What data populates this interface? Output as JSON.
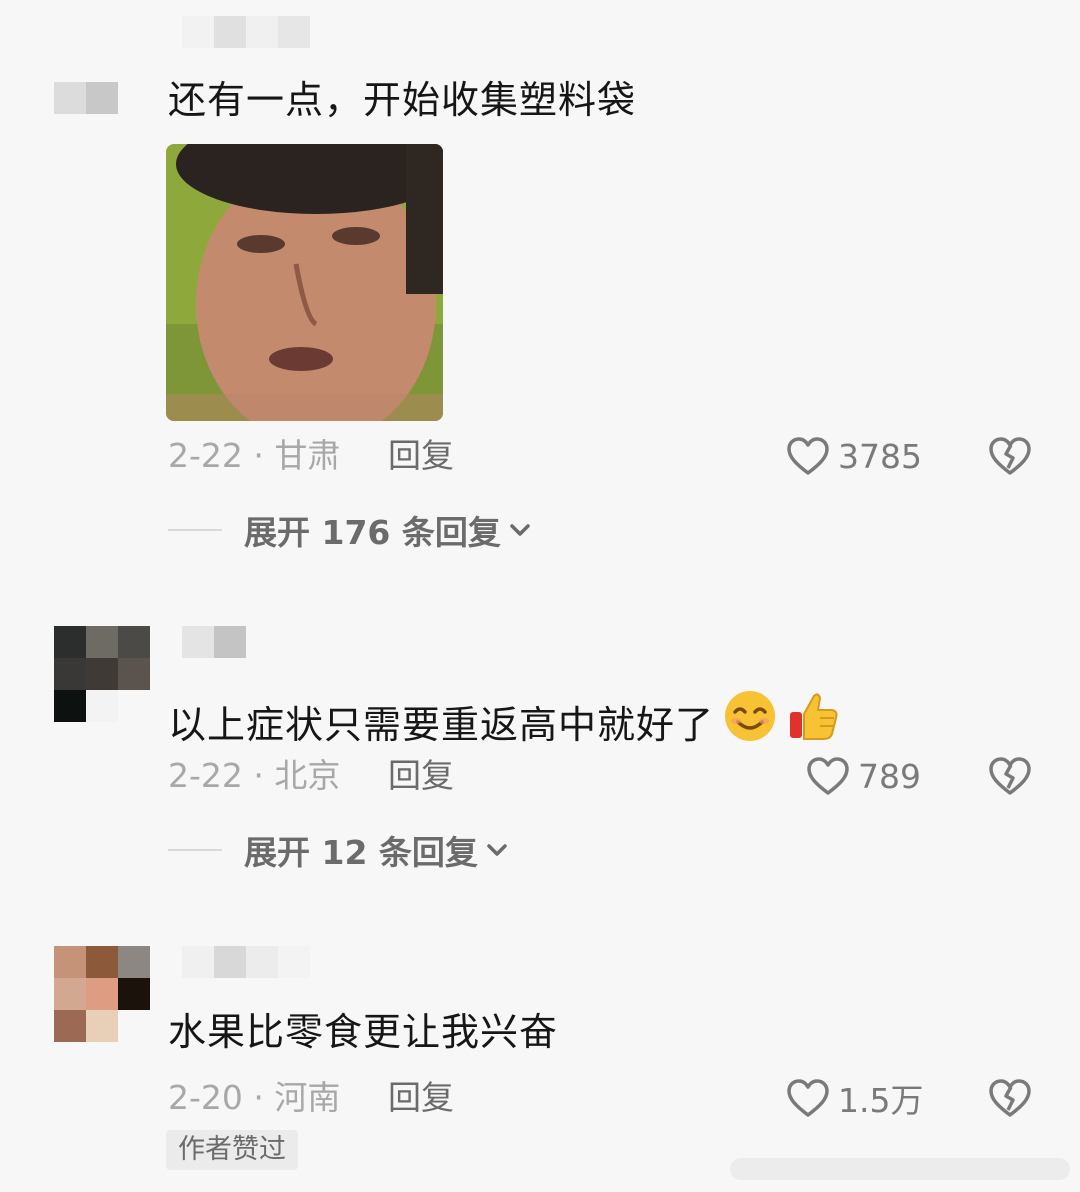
{
  "comments": [
    {
      "text": "还有一点，开始收集塑料袋",
      "date_location": "2-22 · 甘肃",
      "reply_label": "回复",
      "likes": "3785",
      "expand_label": "展开 176 条回复"
    },
    {
      "text": "以上症状只需要重返高中就好了",
      "emojis": [
        "smiling-face-icon",
        "thumbs-up-icon"
      ],
      "date_location": "2-22 · 北京",
      "reply_label": "回复",
      "likes": "789",
      "expand_label": "展开 12 条回复"
    },
    {
      "text": "水果比零食更让我兴奋",
      "date_location": "2-20 · 河南",
      "reply_label": "回复",
      "likes": "1.5万",
      "badge": "作者赞过"
    }
  ],
  "colors": {
    "background": "#f7f7f7",
    "text": "#161616",
    "meta": "#a8a8a8",
    "secondary": "#6b6b6b"
  }
}
